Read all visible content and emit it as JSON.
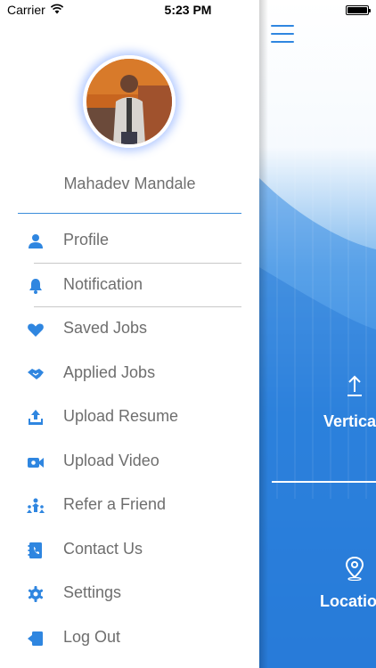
{
  "status_bar": {
    "carrier": "Carrier",
    "time": "5:23 PM"
  },
  "drawer": {
    "user_name": "Mahadev Mandale",
    "menu": [
      {
        "label": "Profile",
        "icon": "person-icon"
      },
      {
        "label": "Notification",
        "icon": "bell-icon"
      },
      {
        "label": "Saved Jobs",
        "icon": "heart-icon"
      },
      {
        "label": "Applied Jobs",
        "icon": "handshake-icon"
      },
      {
        "label": "Upload Resume",
        "icon": "upload-icon"
      },
      {
        "label": "Upload Video",
        "icon": "video-camera-icon"
      },
      {
        "label": "Refer a Friend",
        "icon": "refer-friend-icon"
      },
      {
        "label": "Contact Us",
        "icon": "contact-book-icon"
      },
      {
        "label": "Settings",
        "icon": "gear-icon"
      },
      {
        "label": "Log Out",
        "icon": "logout-icon"
      }
    ]
  },
  "background": {
    "vertical_label": "Vertica",
    "location_label": "Locatio"
  },
  "colors": {
    "accent": "#2f86e0",
    "text": "#6e6e6e"
  }
}
